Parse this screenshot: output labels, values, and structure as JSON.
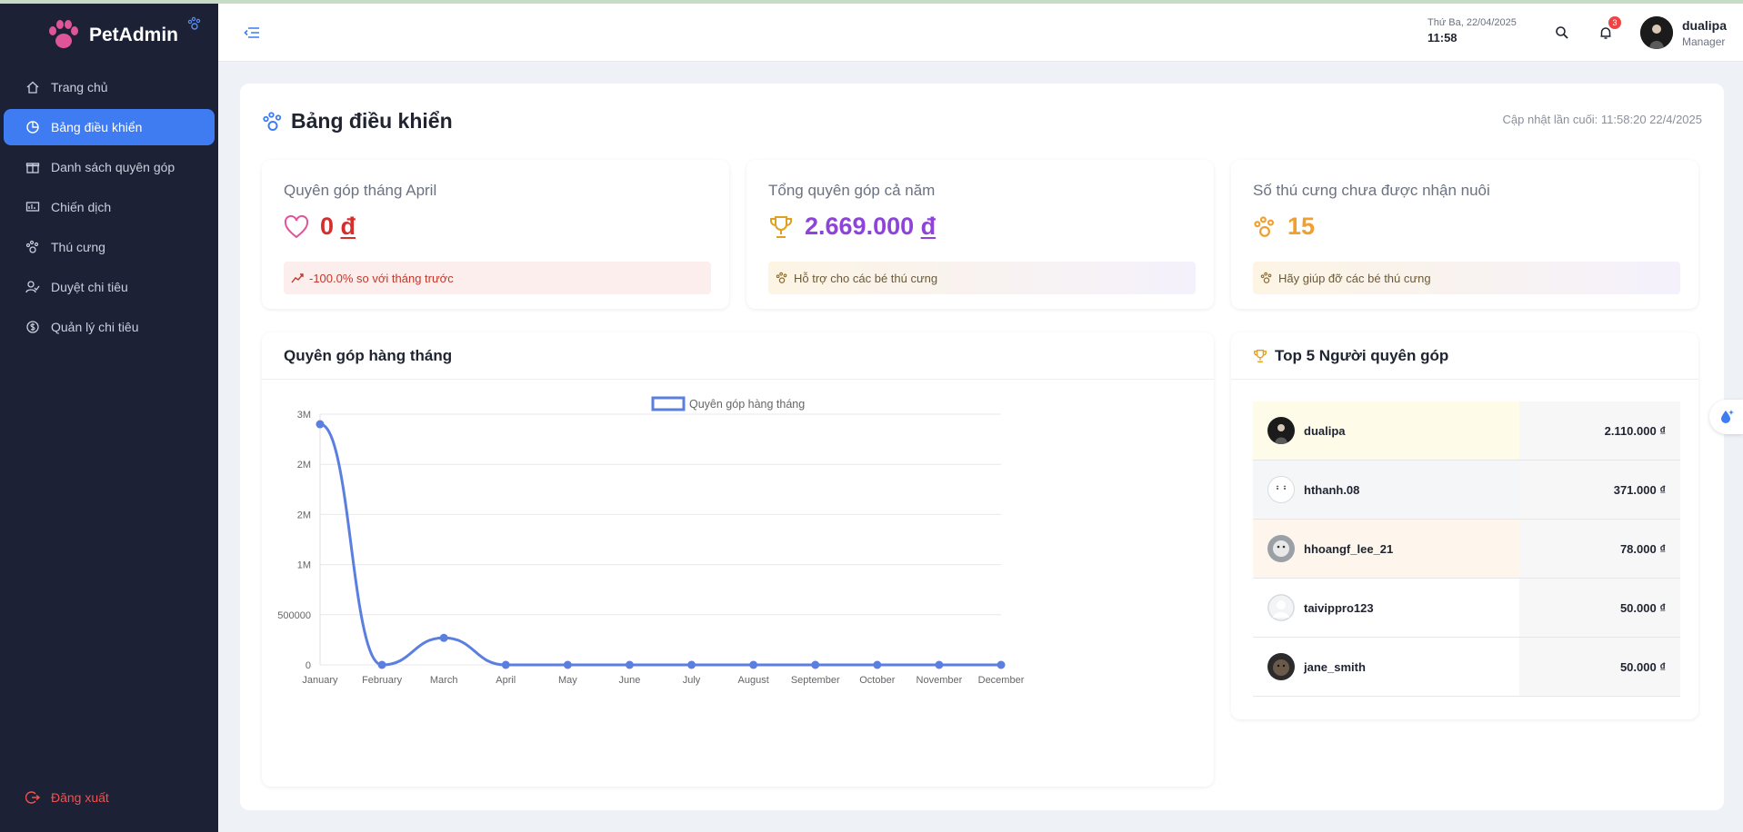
{
  "app": {
    "name": "PetAdmin"
  },
  "sidebar": {
    "items": [
      {
        "label": "Trang chủ",
        "icon": "home-icon"
      },
      {
        "label": "Bảng điều khiển",
        "icon": "dashboard-icon",
        "active": true
      },
      {
        "label": "Danh sách quyên góp",
        "icon": "gift-icon"
      },
      {
        "label": "Chiến dịch",
        "icon": "campaign-icon"
      },
      {
        "label": "Thú cưng",
        "icon": "paw-icon"
      },
      {
        "label": "Duyệt chi tiêu",
        "icon": "approve-icon"
      },
      {
        "label": "Quản lý chi tiêu",
        "icon": "money-icon"
      }
    ],
    "logout_label": "Đăng xuất"
  },
  "header": {
    "date": "Thứ Ba, 22/04/2025",
    "time": "11:58",
    "notification_count": "3",
    "user_name": "dualipa",
    "user_role": "Manager"
  },
  "page": {
    "title": "Bảng điều khiển",
    "last_updated": "Cập nhật lần cuối: 11:58:20 22/4/2025"
  },
  "stats": [
    {
      "label": "Quyên góp tháng April",
      "value": "0",
      "currency": "đ",
      "note": "-100.0% so với tháng trước",
      "color": "#d32f2f"
    },
    {
      "label": "Tổng quyên góp cả năm",
      "value": "2.669.000",
      "currency": "đ",
      "note": "Hỗ trợ cho các bé thú cưng",
      "color": "#8e44d9"
    },
    {
      "label": "Số thú cưng chưa được nhận nuôi",
      "value": "15",
      "currency": "",
      "note": "Hãy giúp đỡ các bé thú cưng",
      "color": "#f0a030"
    }
  ],
  "monthly_card": {
    "title": "Quyên góp hàng tháng"
  },
  "chart_data": {
    "type": "line",
    "categories": [
      "January",
      "February",
      "March",
      "April",
      "May",
      "June",
      "July",
      "August",
      "September",
      "October",
      "November",
      "December"
    ],
    "series": [
      {
        "name": "Quyên góp hàng tháng",
        "values": [
          2400000,
          0,
          269000,
          0,
          0,
          0,
          0,
          0,
          0,
          0,
          0,
          0
        ],
        "color": "#5b7fe0"
      }
    ],
    "yticks": [
      "0",
      "500000",
      "1M",
      "2M",
      "2M",
      "3M"
    ],
    "ylim": [
      0,
      2500000
    ],
    "grid": true,
    "legend": "top"
  },
  "top_donors": {
    "title": "Top 5 Người quyên góp",
    "rows": [
      {
        "name": "dualipa",
        "amount": "2.110.000 ₫",
        "highlight": "#fefbe8"
      },
      {
        "name": "hthanh.08",
        "amount": "371.000 ₫",
        "highlight": "#f5f6f8"
      },
      {
        "name": "hhoangf_lee_21",
        "amount": "78.000 ₫",
        "highlight": "#fef6ec"
      },
      {
        "name": "taivippro123",
        "amount": "50.000 ₫",
        "highlight": "#ffffff"
      },
      {
        "name": "jane_smith",
        "amount": "50.000 ₫",
        "highlight": "#ffffff"
      }
    ]
  }
}
